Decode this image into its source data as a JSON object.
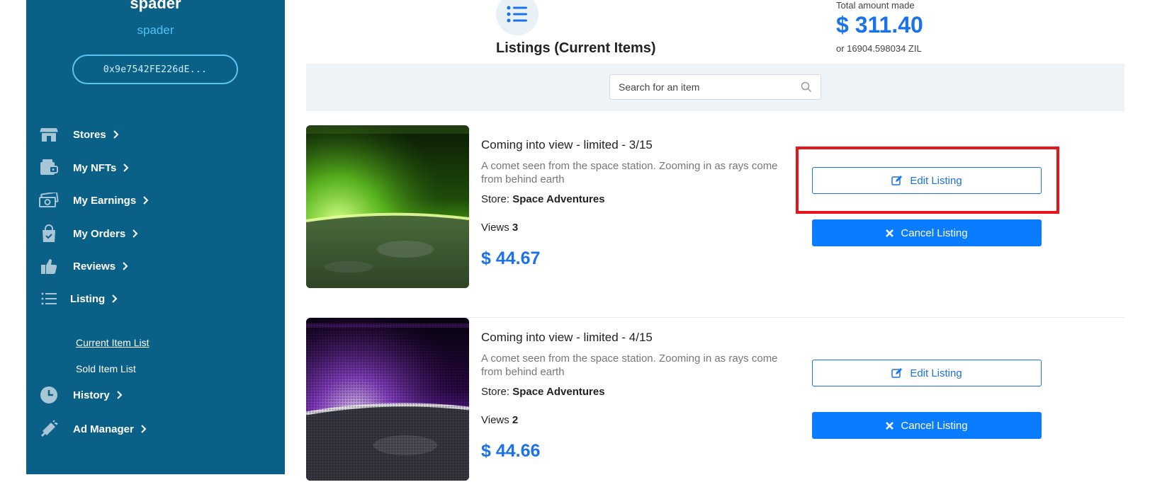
{
  "user": {
    "name": "spader",
    "handle": "spader",
    "wallet": "0x9e7542FE226dE..."
  },
  "nav": {
    "items": [
      {
        "label": "Stores",
        "icon": "store-icon"
      },
      {
        "label": "My NFTs",
        "icon": "nft-icon"
      },
      {
        "label": "My Earnings",
        "icon": "money-icon"
      },
      {
        "label": "My Orders",
        "icon": "shopping-bag-icon"
      },
      {
        "label": "Reviews",
        "icon": "thumbs-up-icon"
      },
      {
        "label": "Listing",
        "icon": "list-icon"
      },
      {
        "label": "History",
        "icon": "clock-icon"
      },
      {
        "label": "Ad Manager",
        "icon": "megaphone-icon"
      }
    ],
    "sub_items": [
      {
        "label": "Current Item List",
        "active": true
      },
      {
        "label": "Sold Item List",
        "active": false
      }
    ]
  },
  "header": {
    "title": "Listings (Current Items)",
    "total_label": "Total amount made",
    "total_amount": "$ 311.40",
    "total_zil": "or 16904.598034 ZIL"
  },
  "search": {
    "placeholder": "Search for an item"
  },
  "listings": [
    {
      "title": "Coming into view - limited - 3/15",
      "description": "A comet seen from the space station. Zooming in as rays come from behind earth",
      "store_label": "Store:",
      "store": "Space Adventures",
      "views_label": "Views",
      "views": "3",
      "price": "$ 44.67",
      "edit_label": "Edit Listing",
      "cancel_label": "Cancel Listing"
    },
    {
      "title": "Coming into view - limited - 4/15",
      "description": "A comet seen from the space station. Zooming in as rays come from behind earth",
      "store_label": "Store:",
      "store": "Space Adventures",
      "views_label": "Views",
      "views": "2",
      "price": "$ 44.66",
      "edit_label": "Edit Listing",
      "cancel_label": "Cancel Listing"
    }
  ],
  "colors": {
    "sidebar": "#0b6087",
    "accent": "#1a73e8",
    "highlight": "#e8141a"
  }
}
